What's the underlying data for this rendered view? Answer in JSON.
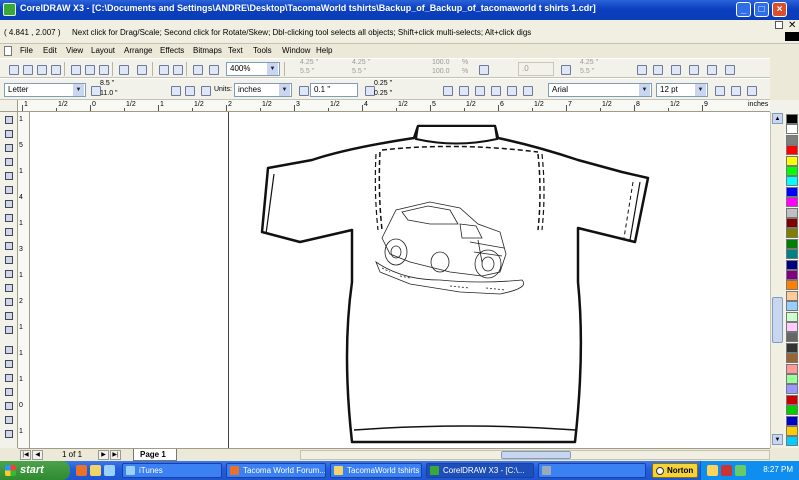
{
  "window": {
    "title": "CorelDRAW X3 - [C:\\Documents and Settings\\ANDRE\\Desktop\\TacomaWorld tshirts\\Backup_of_Backup_of_tacomaworld t shirts 1.cdr]"
  },
  "status": {
    "coords": "( 4.841 , 2.007 )",
    "hint": "Next click for Drag/Scale; Second click for Rotate/Skew; Dbl-clicking tool selects all objects; Shift+click multi-selects; Alt+click digs"
  },
  "menu": [
    "File",
    "Edit",
    "View",
    "Layout",
    "Arrange",
    "Effects",
    "Bitmaps",
    "Text",
    "Tools",
    "Window",
    "Help"
  ],
  "standard_toolbar": {
    "zoom": "400%",
    "greyed": {
      "x": "4.25 \"",
      "y": "5.5 \"",
      "w": "100.0",
      "h": "100.0",
      "pct": "%",
      "angle": ".0",
      "x2": "4.25 \"",
      "y2": "5.5 \""
    }
  },
  "property_bar": {
    "paper": "Letter",
    "width": "8.5 \"",
    "height": "11.0 \"",
    "units_label": "Units:",
    "units": "inches",
    "nudge": "0.1 \"",
    "dup_x": "0.25 \"",
    "dup_y": "0.25 \"",
    "font": "Arial",
    "font_size": "12 pt"
  },
  "ruler": {
    "h_labels": [
      "1",
      "1/2",
      "0",
      "1/2",
      "1",
      "1/2",
      "2",
      "1/2",
      "3",
      "1/2",
      "4",
      "1/2",
      "5",
      "1/2",
      "6",
      "1/2",
      "7",
      "1/2",
      "8",
      "1/2",
      "9"
    ],
    "unit": "inches",
    "v_labels": [
      "1/2",
      "5",
      "1/2",
      "4",
      "1/2",
      "3",
      "1/2",
      "2",
      "1/2",
      "1",
      "1/2",
      "0",
      "1/2"
    ]
  },
  "pages": {
    "count": "1 of 1",
    "tab": "Page 1"
  },
  "taskbar": {
    "start": "start",
    "tasks": [
      {
        "label": "iTunes",
        "icon_color": "#9ad1ff"
      },
      {
        "label": "Tacoma World Forum...",
        "icon_color": "#e8722a"
      },
      {
        "label": "TacomaWorld tshirts",
        "icon_color": "#f3d46a"
      },
      {
        "label": "CorelDRAW X3 - [C:\\...",
        "icon_color": "#39a83a"
      },
      {
        "label": "",
        "icon_color": "#9ab"
      }
    ],
    "norton": "Norton",
    "clock": "8:27 PM"
  },
  "colors": {
    "title_blue": "#0b3fbf",
    "taskbar_blue": "#245edb",
    "start_green": "#2f8b2f"
  },
  "palette": [
    "#000000",
    "#ffffff",
    "#7f7f7f",
    "#ff0000",
    "#ffff00",
    "#00ff00",
    "#00ffff",
    "#0000ff",
    "#ff00ff",
    "#c0c0c0",
    "#800000",
    "#808000",
    "#008000",
    "#008080",
    "#000080",
    "#800080",
    "#ff8000",
    "#ffcc99",
    "#99ccff",
    "#ccffcc",
    "#ffccff",
    "#666666",
    "#333333",
    "#996633",
    "#ff9999",
    "#99ff99",
    "#9999ff",
    "#cc0000",
    "#00cc00",
    "#0000cc",
    "#ffcc00",
    "#00ccff"
  ]
}
